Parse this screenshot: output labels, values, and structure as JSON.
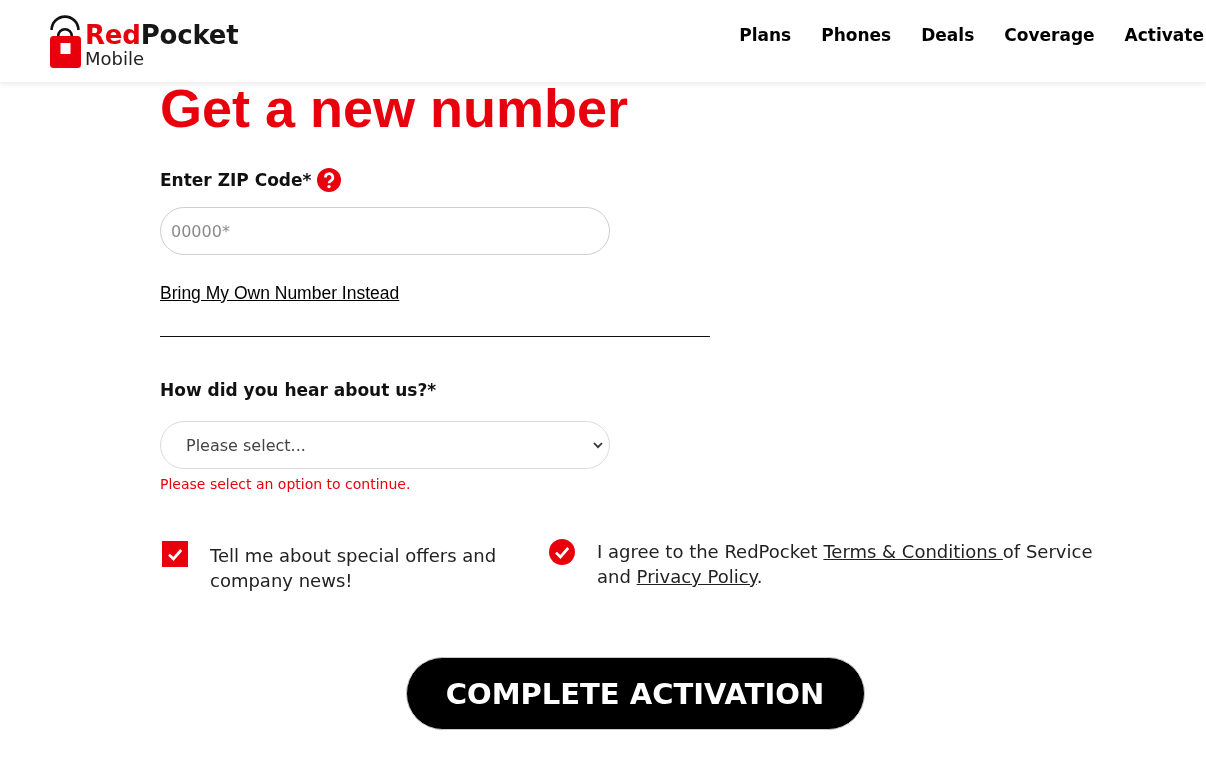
{
  "header": {
    "logo": {
      "brand": [
        {
          "text": "Red",
          "color": "#e8000d"
        },
        {
          "text": "Pocket",
          "color": "#161616"
        }
      ],
      "tagline": "Mobile"
    },
    "nav": [
      "Plans",
      "Phones",
      "Deals",
      "Coverage",
      "Activate"
    ]
  },
  "form": {
    "title": "Get a new number",
    "zip": {
      "label": "Enter ZIP Code*",
      "placeholder": "00000*"
    },
    "alt_link": "Bring My Own Number Instead",
    "referral": {
      "label": "How did you hear about us?*",
      "value": "Please select...",
      "error": "Please select an option to continue."
    },
    "consents": [
      {
        "kind": "square",
        "checked": true,
        "segments": [
          {
            "kind": "plain",
            "text": "Tell me about special offers and company news!"
          }
        ]
      },
      {
        "kind": "circle",
        "checked": true,
        "segments": [
          {
            "kind": "plain",
            "text": "I agree to the RedPocket "
          },
          {
            "kind": "link",
            "text": "Terms & Conditions "
          },
          {
            "kind": "plain",
            "text": "of Service and "
          },
          {
            "kind": "link",
            "text": "Privacy Policy"
          },
          {
            "kind": "plain",
            "text": "."
          }
        ]
      }
    ],
    "submit": "COMPLETE ACTIVATION"
  }
}
